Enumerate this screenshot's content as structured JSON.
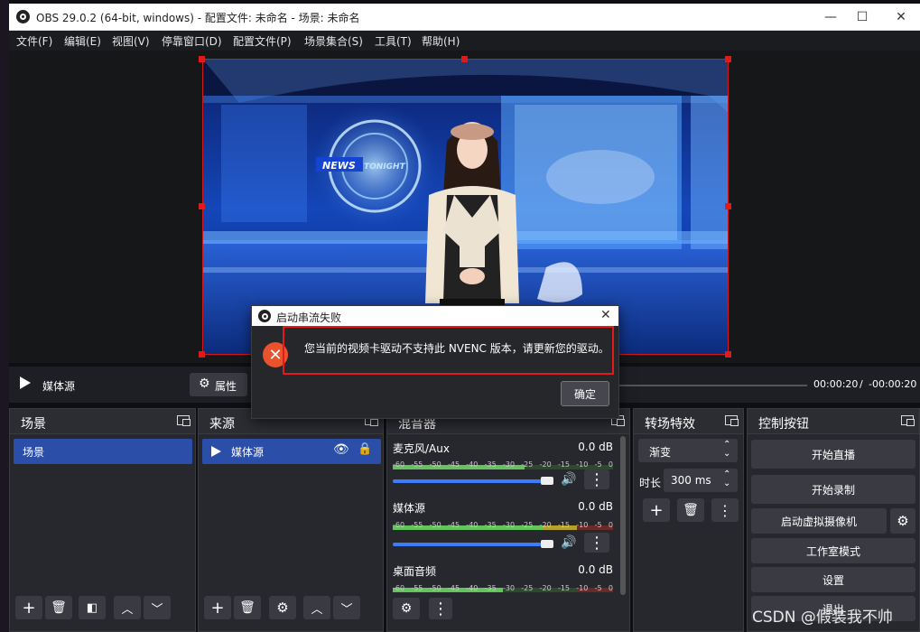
{
  "window": {
    "title": "OBS 29.0.2 (64-bit, windows) - 配置文件: 未命名 - 场景: 未命名"
  },
  "menu": [
    "文件(F)",
    "编辑(E)",
    "视图(V)",
    "停靠窗口(D)",
    "配置文件(P)",
    "场景集合(S)",
    "工具(T)",
    "帮助(H)"
  ],
  "video": {
    "badge_news": "NEWS",
    "badge_tonight": "TONIGHT"
  },
  "playbar": {
    "source_name": "媒体源",
    "properties_label": "属性",
    "time_current": "00:00:20",
    "time_sep": "/",
    "time_remaining": "-00:00:20"
  },
  "docks": {
    "scenes": {
      "title": "场景",
      "items": [
        "场景"
      ]
    },
    "sources": {
      "title": "来源",
      "items": [
        "媒体源"
      ]
    },
    "mixer": {
      "title": "混音器",
      "channels": [
        {
          "name": "麦克风/Aux",
          "db": "0.0 dB",
          "level": 0.6
        },
        {
          "name": "媒体源",
          "db": "0.0 dB",
          "level": 0.72
        },
        {
          "name": "桌面音频",
          "db": "0.0 dB",
          "level": 0.5
        }
      ],
      "ticks": [
        "-60",
        "-55",
        "-50",
        "-45",
        "-40",
        "-35",
        "-30",
        "-25",
        "-20",
        "-15",
        "-10",
        "-5",
        "0"
      ]
    },
    "transitions": {
      "title": "转场特效",
      "type": "渐变",
      "duration_label": "时长",
      "duration_value": "300 ms"
    },
    "controls": {
      "title": "控制按钮",
      "buttons": [
        "开始直播",
        "开始录制",
        "启动虚拟摄像机",
        "工作室模式",
        "设置",
        "退出"
      ]
    }
  },
  "dialog": {
    "title": "启动串流失败",
    "message": "您当前的视频卡驱动不支持此 NVENC 版本，请更新您的驱动。",
    "ok_label": "确定"
  },
  "watermark": "CSDN @假装我不帅",
  "colors": {
    "accent": "#2b4fa8",
    "error": "#e8522c",
    "highlight_box": "#e11b1b"
  }
}
